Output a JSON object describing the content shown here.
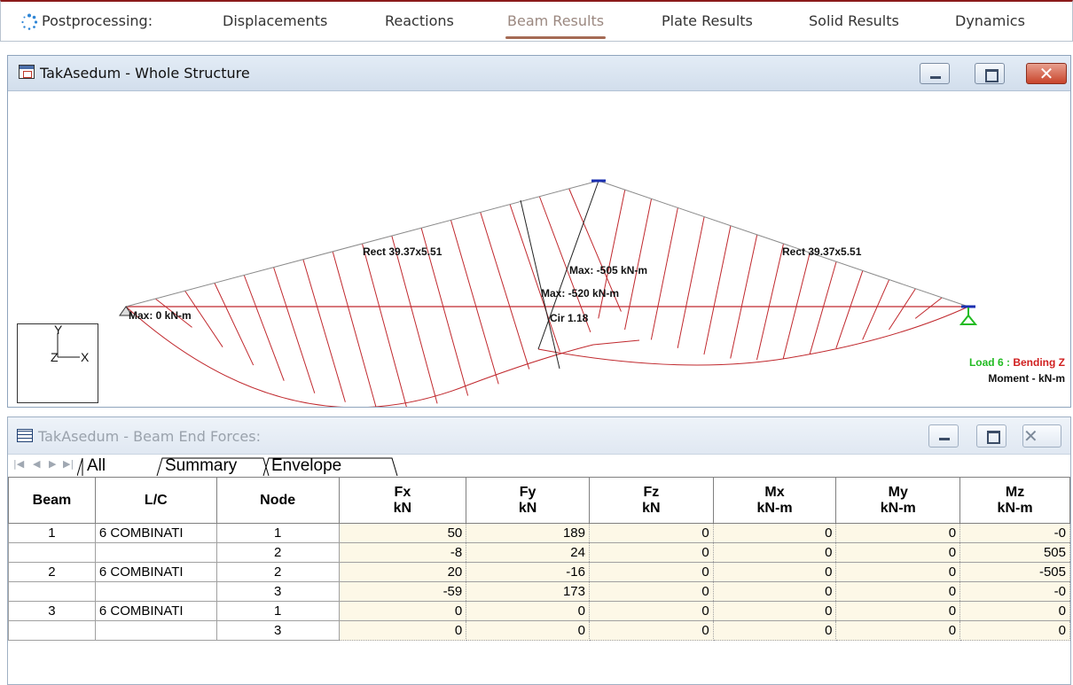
{
  "postprocessing": {
    "label": "Postprocessing:",
    "tabs": [
      {
        "label": "Displacements"
      },
      {
        "label": "Reactions"
      },
      {
        "label": "Beam Results"
      },
      {
        "label": "Plate Results"
      },
      {
        "label": "Solid Results"
      },
      {
        "label": "Dynamics"
      }
    ],
    "active_tab": "Beam Results"
  },
  "structure_window": {
    "title": "TakAsedum - Whole Structure",
    "annotations": {
      "section_left": "Rect 39.37x5.51",
      "section_right": "Rect 39.37x5.51",
      "max_top": "Max: -505 kN-m",
      "max_mid": "Max: -520 kN-m",
      "max_left": "Max: 0 kN-m",
      "cir": "Cir 1.18"
    },
    "axes": {
      "y": "Y",
      "z": "Z",
      "x": "X"
    },
    "legend": {
      "load": "Load 6 :",
      "type": "Bending Z",
      "units": "Moment - kN-m"
    },
    "colors": {
      "diagram": "#c0282d",
      "member": "#c0282d",
      "support": "#22bb22",
      "load_text": "#22bb22",
      "bending_text": "#d01f1f"
    }
  },
  "forces_window": {
    "title": "TakAsedum - Beam End Forces:",
    "sheet_tabs": [
      "All",
      "Summary",
      "Envelope"
    ],
    "columns": [
      {
        "l1": "Beam",
        "l2": ""
      },
      {
        "l1": "L/C",
        "l2": ""
      },
      {
        "l1": "Node",
        "l2": ""
      },
      {
        "l1": "Fx",
        "l2": "kN"
      },
      {
        "l1": "Fy",
        "l2": "kN"
      },
      {
        "l1": "Fz",
        "l2": "kN"
      },
      {
        "l1": "Mx",
        "l2": "kN-m"
      },
      {
        "l1": "My",
        "l2": "kN-m"
      },
      {
        "l1": "Mz",
        "l2": "kN-m"
      }
    ],
    "rows": [
      {
        "beam": "1",
        "lc": "6 COMBINATI",
        "node": "1",
        "fx": "50",
        "fy": "189",
        "fz": "0",
        "mx": "0",
        "my": "0",
        "mz": "-0"
      },
      {
        "beam": "",
        "lc": "",
        "node": "2",
        "fx": "-8",
        "fy": "24",
        "fz": "0",
        "mx": "0",
        "my": "0",
        "mz": "505"
      },
      {
        "beam": "2",
        "lc": "6 COMBINATI",
        "node": "2",
        "fx": "20",
        "fy": "-16",
        "fz": "0",
        "mx": "0",
        "my": "0",
        "mz": "-505"
      },
      {
        "beam": "",
        "lc": "",
        "node": "3",
        "fx": "-59",
        "fy": "173",
        "fz": "0",
        "mx": "0",
        "my": "0",
        "mz": "-0"
      },
      {
        "beam": "3",
        "lc": "6 COMBINATI",
        "node": "1",
        "fx": "0",
        "fy": "0",
        "fz": "0",
        "mx": "0",
        "my": "0",
        "mz": "0"
      },
      {
        "beam": "",
        "lc": "",
        "node": "3",
        "fx": "0",
        "fy": "0",
        "fz": "0",
        "mx": "0",
        "my": "0",
        "mz": "0"
      }
    ]
  }
}
